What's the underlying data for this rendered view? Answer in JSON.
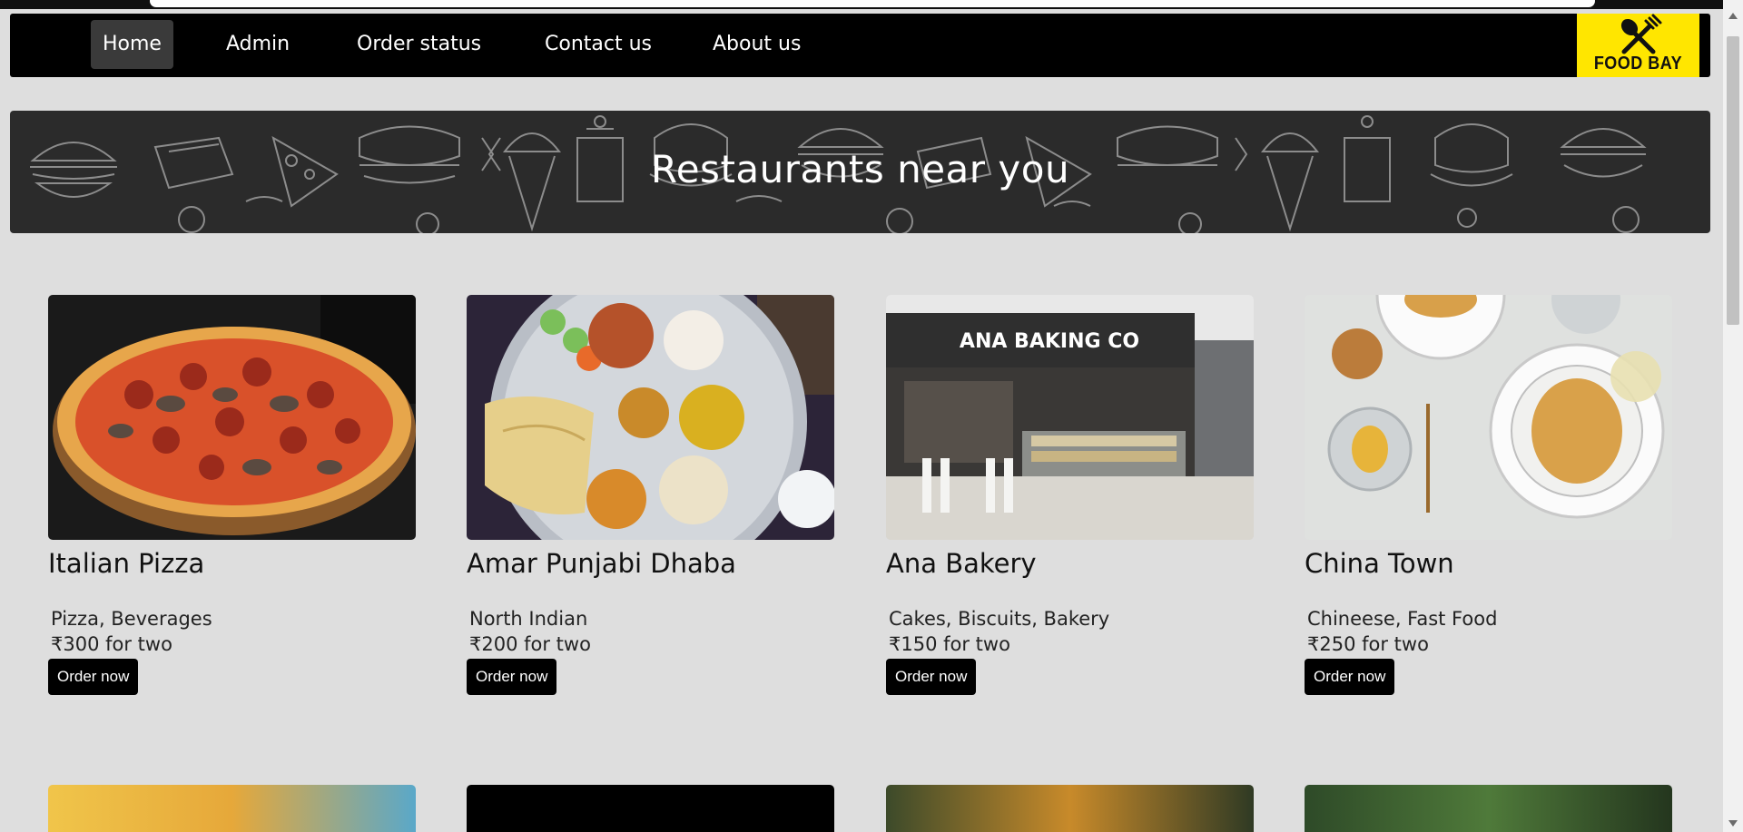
{
  "nav": {
    "items": [
      {
        "label": "Home"
      },
      {
        "label": "Admin"
      },
      {
        "label": "Order status"
      },
      {
        "label": "Contact us"
      },
      {
        "label": "About us"
      }
    ],
    "active": "Home",
    "logo_text": "FOOD BAY",
    "logo_icon": "fork-knife-icon",
    "logo_bg": "#ffe600"
  },
  "banner": {
    "title": "Restaurants near you"
  },
  "restaurants": [
    {
      "name": "Italian Pizza",
      "cuisine": "Pizza, Beverages",
      "price": "₹300 for two",
      "button": "Order now",
      "image": "pizza-photo"
    },
    {
      "name": "Amar Punjabi Dhaba",
      "cuisine": "North Indian",
      "price": "₹200 for two",
      "button": "Order now",
      "image": "thali-photo"
    },
    {
      "name": "Ana Bakery",
      "cuisine": "Cakes, Biscuits, Bakery",
      "price": "₹150 for two",
      "button": "Order now",
      "image": "bakery-photo"
    },
    {
      "name": "China Town",
      "cuisine": "Chineese, Fast Food",
      "price": "₹250 for two",
      "button": "Order now",
      "image": "noodles-photo"
    }
  ],
  "colors": {
    "navbar": "#000000",
    "page_bg": "#dedede",
    "banner_bg": "#2b2b2b",
    "button_bg": "#000000"
  }
}
